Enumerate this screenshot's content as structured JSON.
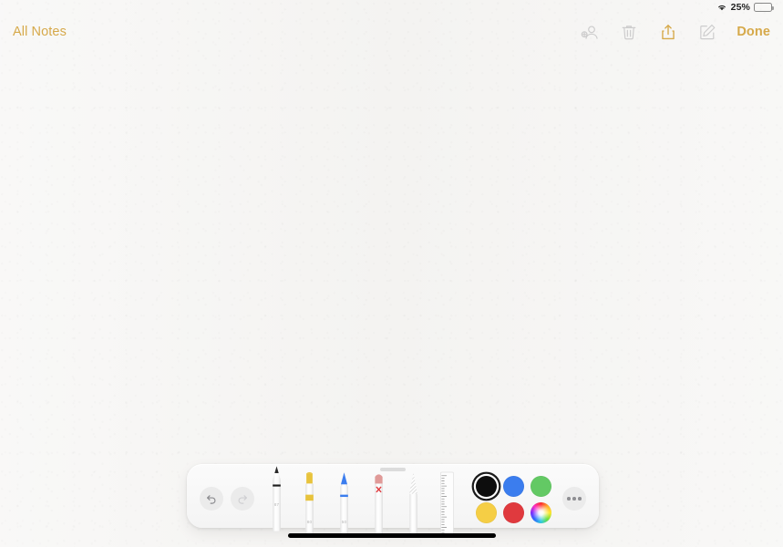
{
  "status_bar": {
    "wifi_icon": "wifi-icon",
    "battery_percent": "25%",
    "battery_level": 25,
    "battery_icon": "battery-icon"
  },
  "nav_bar": {
    "back_label": "All Notes",
    "done_label": "Done",
    "accent_color": "#d6a94a",
    "actions": [
      {
        "name": "add-collaborator-icon",
        "label": "Add People",
        "enabled": false
      },
      {
        "name": "trash-icon",
        "label": "Delete",
        "enabled": false
      },
      {
        "name": "share-icon",
        "label": "Share",
        "enabled": true
      },
      {
        "name": "compose-icon",
        "label": "New Note",
        "enabled": false
      }
    ]
  },
  "canvas": {
    "content": "",
    "background_color": "#f3f2f0"
  },
  "tool_palette": {
    "grabber": "drag-handle",
    "undo": {
      "label": "Undo",
      "enabled": true
    },
    "redo": {
      "label": "Redo",
      "enabled": false
    },
    "more": {
      "label": "More",
      "icon": "ellipsis-icon"
    },
    "tools": [
      {
        "name": "pen",
        "label": "Pen",
        "opacity_label": "87",
        "tip_color": "#2a2a2a",
        "selected": true
      },
      {
        "name": "highlighter",
        "label": "Highlighter",
        "opacity_label": "80",
        "tip_color": "#e8c33c",
        "selected": false
      },
      {
        "name": "marker",
        "label": "Marker",
        "opacity_label": "50",
        "tip_color": "#3b7dee",
        "selected": false
      },
      {
        "name": "eraser",
        "label": "Eraser",
        "opacity_label": "",
        "tip_color": "#e09a98",
        "selected": false
      },
      {
        "name": "lasso",
        "label": "Lasso",
        "opacity_label": "",
        "tip_color": "#c9c9c9",
        "selected": false
      },
      {
        "name": "ruler",
        "label": "Ruler",
        "opacity_label": "",
        "tip_color": "#ffffff",
        "selected": false
      }
    ],
    "colors": [
      {
        "name": "black",
        "hex": "#0d0d0d",
        "selected": true
      },
      {
        "name": "blue",
        "hex": "#3b7dee",
        "selected": false
      },
      {
        "name": "green",
        "hex": "#63c964",
        "selected": false
      },
      {
        "name": "yellow",
        "hex": "#f5ce45",
        "selected": false
      },
      {
        "name": "red",
        "hex": "#e03a3e",
        "selected": false
      },
      {
        "name": "wheel",
        "hex": "rainbow",
        "selected": false
      }
    ]
  },
  "home_indicator": {
    "label": "Home Indicator"
  }
}
